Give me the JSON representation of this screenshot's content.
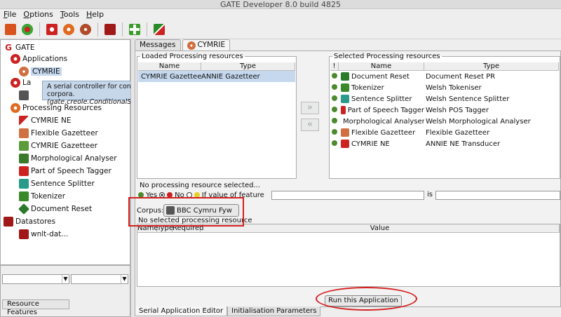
{
  "window": {
    "title": "GATE Developer 8.0 build 4825"
  },
  "menu": [
    {
      "pre": "",
      "u": "F",
      "post": "ile"
    },
    {
      "pre": "",
      "u": "O",
      "post": "ptions"
    },
    {
      "pre": "",
      "u": "T",
      "post": "ools"
    },
    {
      "pre": "",
      "u": "H",
      "post": "elp"
    }
  ],
  "tree": {
    "root": "GATE",
    "applications": "Applications",
    "app_cymrie": "CYMRIE",
    "language_resources_partial": "La",
    "processing_resources": "Processing Resources",
    "pr_items": [
      "CYMRIE NE",
      "Flexible Gazetteer",
      "CYMRIE Gazetteer",
      "Morphological Analyser",
      "Part of Speech Tagger",
      "Sentence Splitter",
      "Tokenizer",
      "Document Reset"
    ],
    "datastores": "Datastores",
    "datastore_item": "wnlt-dat..."
  },
  "tooltip": {
    "line1": "A serial controller for conditionally run PR pipelines over corpora.",
    "line2": "(gate.creole.ConditionalSerialAnalyserController)"
  },
  "left_bottom": {
    "resource_features_tab": "Resource Features"
  },
  "tabs": [
    {
      "label": "Messages"
    },
    {
      "label": "CYMRIE"
    }
  ],
  "loaded": {
    "title": "Loaded Processing resources",
    "headers": [
      "Name",
      "Type"
    ],
    "rows": [
      {
        "name": "CYMRIE Gazetteer",
        "type": "ANNIE Gazetteer"
      }
    ]
  },
  "selected": {
    "title": "Selected Processing resources",
    "headers": [
      "!",
      "Name",
      "Type"
    ],
    "rows": [
      {
        "name": "Document Reset",
        "type": "Document Reset PR"
      },
      {
        "name": "Tokenizer",
        "type": "Welsh Tokeniser"
      },
      {
        "name": "Sentence Splitter",
        "type": "Welsh Sentence Splitter"
      },
      {
        "name": "Part of Speech Tagger",
        "type": "Welsh POS Tagger"
      },
      {
        "name": "Morphological Analyser",
        "type": "Welsh Morphological Analyser"
      },
      {
        "name": "Flexible Gazetteer",
        "type": "Flexible Gazetteer"
      },
      {
        "name": "CYMRIE NE",
        "type": "ANNIE NE Transducer"
      }
    ]
  },
  "move_buttons": {
    "right": "»",
    "left": "«"
  },
  "run_mode": {
    "title": "No processing resource selected...",
    "yes": "Yes",
    "no": "No",
    "if_feature": "If value of feature",
    "is": "is"
  },
  "corpus": {
    "label": "Corpus:",
    "value": "BBC Cymru Fyw"
  },
  "params": {
    "title": "No selected processing resource",
    "headers": [
      "Name",
      "Type",
      "Required",
      "Value"
    ]
  },
  "run_button": {
    "label": "Run this Application"
  },
  "bottom_tabs": [
    {
      "label": "Serial Application Editor"
    },
    {
      "label": "Initialisation Parameters"
    }
  ],
  "colors": {
    "highlight_red": "#d42020",
    "selection_blue": "#c5d8ee",
    "run_green": "#4c8a2e"
  }
}
